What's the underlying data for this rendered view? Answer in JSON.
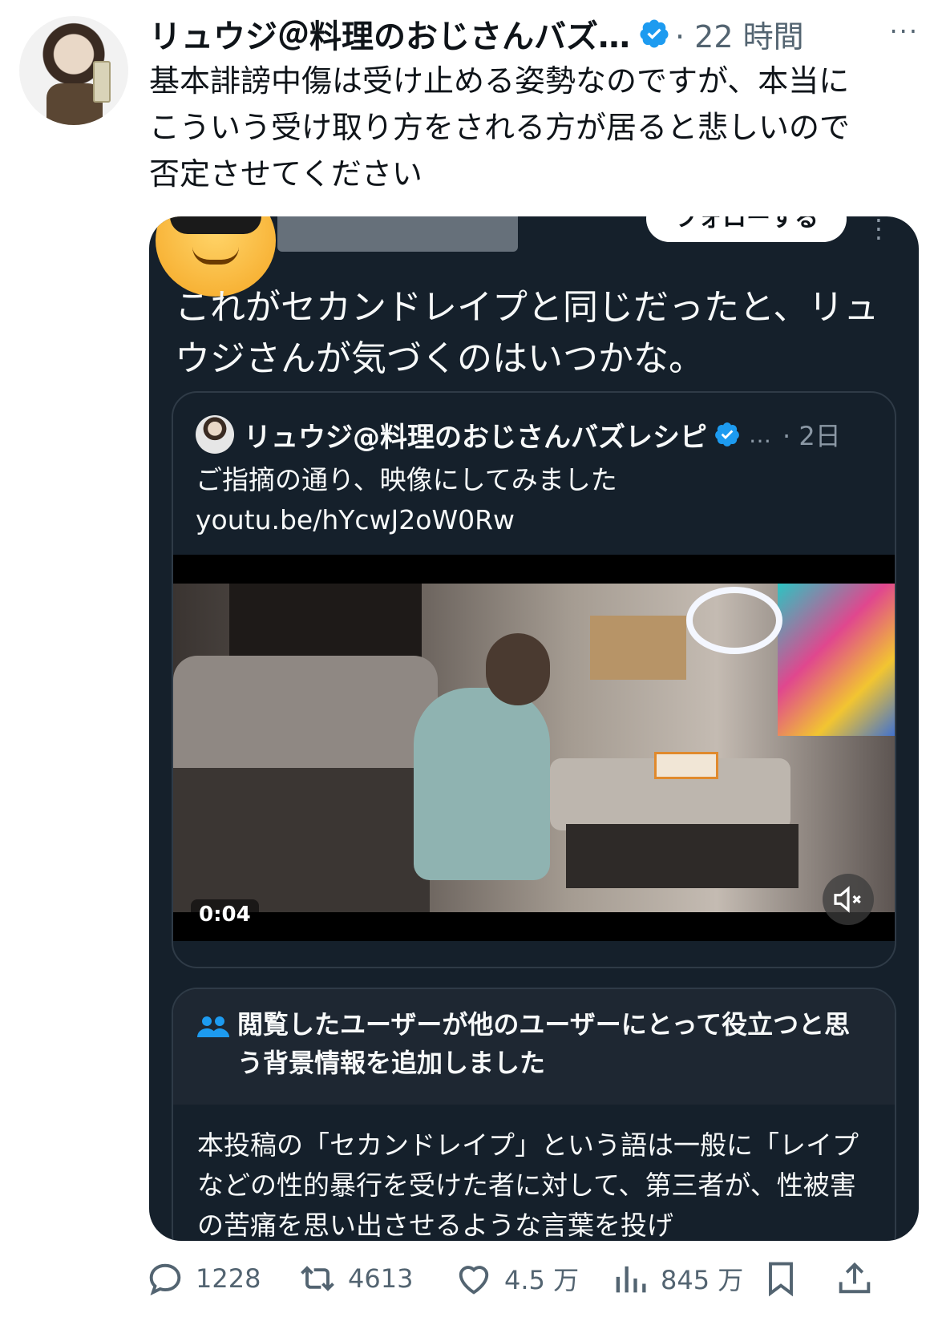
{
  "tweet": {
    "author_name": "リュウジ＠料理のおじさんバズ…",
    "time": "· 22 時間",
    "more": "···",
    "text": "基本誹謗中傷は受け止める姿勢なのですが、本当にこういう受け取り方をされる方が居ると悲しいので否定させてください"
  },
  "quote": {
    "follow_label": "フォローする",
    "more": "⋮",
    "text": "これがセカンドレイプと同じだったと、リュウジさんが気づくのはいつかな。",
    "inner": {
      "author_name": "リュウジ@料理のおじさんバズレシピ",
      "dots": "…",
      "time": "· 2日",
      "text_line1": "ご指摘の通り、映像にしてみました",
      "text_line2": "youtu.be/hYcwJ2oW0Rw",
      "video_time": "0:04"
    },
    "note": {
      "title": "閲覧したユーザーが他のユーザーにとって役立つと思う背景情報を追加しました",
      "body": "本投稿の「セカンドレイプ」という語は一般に「レイプなどの性的暴行を受けた者に対して、第三者が、性被害の苦痛を思い出させるような言葉を投げ"
    }
  },
  "actions": {
    "replies": "1228",
    "retweets": "4613",
    "likes": "4.5 万",
    "views": "845 万"
  },
  "colors": {
    "accent": "#1d9bf0",
    "card_bg": "#15202b",
    "muted": "#536471"
  }
}
